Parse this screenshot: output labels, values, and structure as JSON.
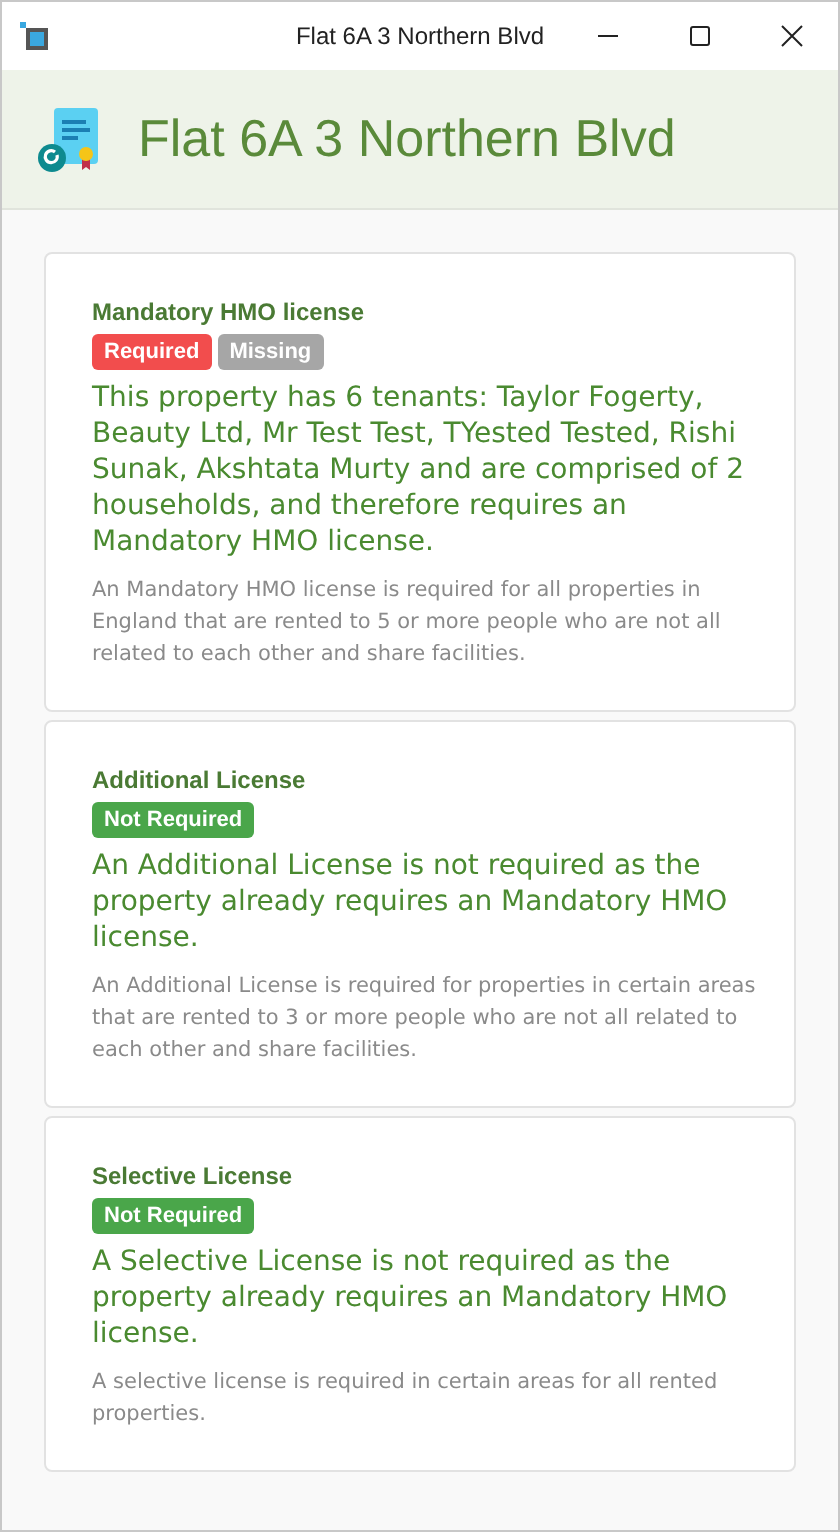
{
  "window": {
    "title": "Flat 6A 3 Northern Blvd"
  },
  "header": {
    "title": "Flat 6A 3 Northern Blvd"
  },
  "licenses": [
    {
      "title": "Mandatory HMO license",
      "badges": [
        {
          "label": "Required",
          "kind": "required"
        },
        {
          "label": "Missing",
          "kind": "missing"
        }
      ],
      "statement": "This property has 6 tenants: Taylor Fogerty, Beauty Ltd, Mr Test Test, TYested Tested, Rishi Sunak, Akshtata Murty and are comprised of 2 households, and therefore requires an Mandatory HMO license.",
      "note": "An Mandatory HMO license is required for all properties in England that are rented to 5 or more people who are not all related to each other and share facilities."
    },
    {
      "title": "Additional License",
      "badges": [
        {
          "label": "Not Required",
          "kind": "not_required"
        }
      ],
      "statement": "An Additional License is not required as the property already requires an Mandatory HMO license.",
      "note": "An Additional License is required for properties in certain areas that are rented to 3 or more people who are not all related to each other and share facilities."
    },
    {
      "title": "Selective License",
      "badges": [
        {
          "label": "Not Required",
          "kind": "not_required"
        }
      ],
      "statement": "A Selective License is not required as the property already requires an Mandatory HMO license.",
      "note": "A selective license is required in certain areas for all rented properties."
    }
  ]
}
